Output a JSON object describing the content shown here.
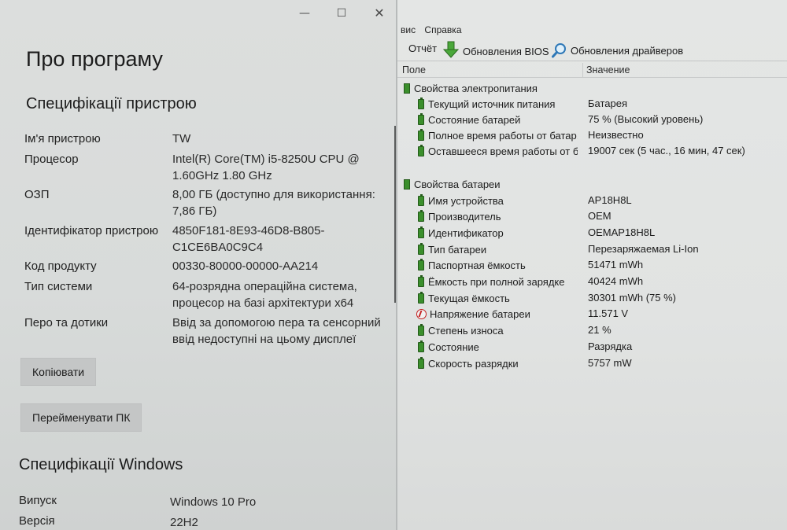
{
  "settings": {
    "page_title": "Про програму",
    "device_section_title": "Специфікації пристрою",
    "specs": [
      {
        "label": "Ім'я пристрою",
        "value": "TW"
      },
      {
        "label": "Процесор",
        "value": "Intel(R) Core(TM) i5-8250U CPU @\n1.60GHz   1.80 GHz"
      },
      {
        "label": "ОЗП",
        "value": "8,00 ГБ (доступно для використання:\n7,86 ГБ)"
      },
      {
        "label": "Ідентифікатор пристрою",
        "value": "4850F181-8E93-46D8-B805-\nC1CE6BA0C9C4"
      },
      {
        "label": "Код продукту",
        "value": "00330-80000-00000-AA214"
      },
      {
        "label": "Тип системи",
        "value": "64-розрядна операційна система,\nпроцесор на базі архітектури x64"
      },
      {
        "label": "Перо та дотики",
        "value": "Ввід за допомогою пера та сенсорний\nввід недоступні на цьому дисплеї"
      }
    ],
    "copy_button": "Копіювати",
    "rename_button": "Перейменувати ПК",
    "windows_section_title": "Специфікації Windows",
    "windows_specs": [
      {
        "label": "Випуск",
        "value": "Windows 10 Pro"
      },
      {
        "label": "Версія",
        "value": "22H2"
      }
    ],
    "window_controls": {
      "minimize": "—",
      "maximize": "☐",
      "close": "✕"
    }
  },
  "aida": {
    "menu": [
      "вис",
      "Справка"
    ],
    "toolbar": {
      "report": "Отчёт",
      "bios_updates": "Обновления BIOS",
      "driver_updates": "Обновления драйверов"
    },
    "icons": {
      "bios": "green-down-arrow-icon",
      "drivers": "magnifier-icon"
    },
    "columns": {
      "field": "Поле",
      "value": "Значение"
    },
    "groups": [
      {
        "name": "Свойства электропитания",
        "items": [
          {
            "name": "Текущий источник питания",
            "value": "Батарея",
            "icon": "battery-icon"
          },
          {
            "name": "Состояние батарей",
            "value": "75 % (Высокий уровень)",
            "icon": "battery-icon"
          },
          {
            "name": "Полное время работы от батар...",
            "value": "Неизвестно",
            "icon": "battery-icon"
          },
          {
            "name": "Оставшееся время работы от б...",
            "value": "19007 сек (5 час., 16 мин, 47 сек)",
            "icon": "battery-icon"
          }
        ]
      },
      {
        "name": "Свойства батареи",
        "items": [
          {
            "name": "Имя устройства",
            "value": "AP18H8L",
            "icon": "battery-icon"
          },
          {
            "name": "Производитель",
            "value": "OEM",
            "icon": "battery-icon"
          },
          {
            "name": "Идентификатор",
            "value": "OEMAP18H8L",
            "icon": "battery-icon"
          },
          {
            "name": "Тип батареи",
            "value": "Перезаряжаемая Li-Ion",
            "icon": "battery-icon"
          },
          {
            "name": "Паспортная ёмкость",
            "value": "51471 mWh",
            "icon": "battery-icon"
          },
          {
            "name": "Ёмкость при полной зарядке",
            "value": "40424 mWh",
            "icon": "battery-icon"
          },
          {
            "name": "Текущая ёмкость",
            "value": "30301 mWh  (75 %)",
            "icon": "battery-icon"
          },
          {
            "name": "Напряжение батареи",
            "value": "11.571 V",
            "icon": "voltage-icon"
          },
          {
            "name": "Степень износа",
            "value": "21 %",
            "icon": "battery-icon"
          },
          {
            "name": "Состояние",
            "value": "Разрядка",
            "icon": "battery-icon"
          },
          {
            "name": "Скорость разрядки",
            "value": "5757 mW",
            "icon": "battery-icon"
          }
        ]
      }
    ],
    "colors": {
      "battery_green": "#3b8f2c",
      "voltage_red": "#c42020"
    }
  }
}
